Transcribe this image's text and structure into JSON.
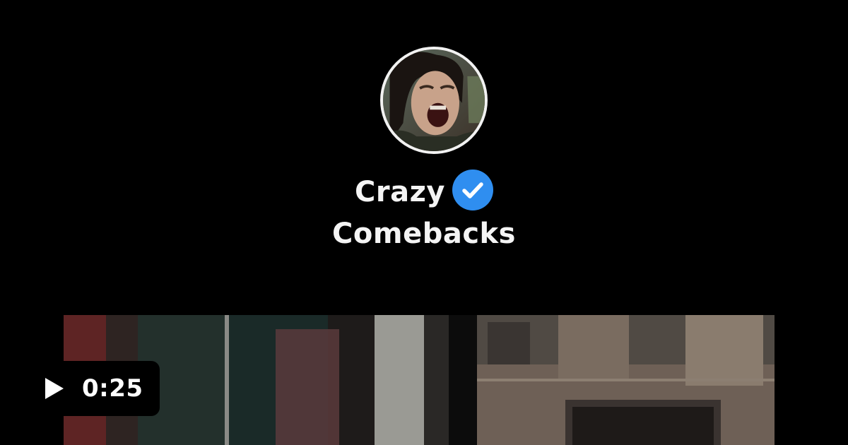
{
  "profile": {
    "name_line1": "Crazy",
    "name_line2": "Comebacks",
    "avatar_icon": "avatar",
    "verified_icon": "verified-check-icon",
    "verified_color": "#2f8ef0"
  },
  "player": {
    "duration": "0:25",
    "play_icon": "play-icon",
    "badge_color": "#000000"
  },
  "theme": {
    "background": "#000000",
    "text_color": "#f4f4f4"
  }
}
